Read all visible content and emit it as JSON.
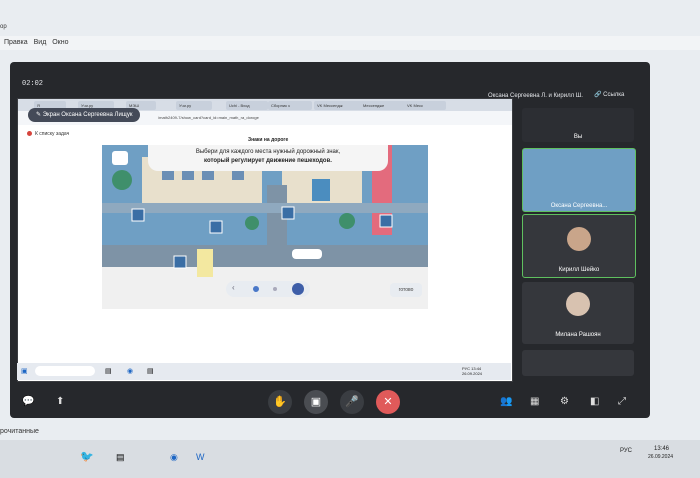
{
  "host": {
    "left_fragment": "ор",
    "menu": [
      "Правка",
      "Вид",
      "Окно"
    ],
    "bottom_fragment": "рочитанные",
    "clock_time": "13:46",
    "clock_date": "26.09.2024",
    "lang": "РУС"
  },
  "meeting": {
    "timer": "02:02",
    "title": "Оксана Сергеевна Л. и Кирилл Ш.",
    "link_label": "Ссылка",
    "screen_badge": "Экран Оксана Сергеевна Лищук",
    "you_label": "Вы"
  },
  "browser": {
    "tabs": [
      "Я",
      "Учи.ру",
      "МЭШ",
      "Учи.ру",
      "Uchi - Вход",
      "Сборник з",
      "VK Мессендж",
      "Мессендже",
      "VK Месс"
    ],
    "url": "/math2409-7/show_card?card_id=main_math_ra_doroge",
    "back_label": "К списку задач"
  },
  "task": {
    "title": "Знаки на дороге",
    "instruction_1": "Выбери для каждого места нужный дорожный знак,",
    "instruction_2": "который регулирует движение пешеходов.",
    "done_label": "готово",
    "time": "13:44",
    "date": "26.09.2024",
    "lang": "РУС"
  },
  "participants": [
    {
      "name": "Оксана Сергеевна..."
    },
    {
      "name": "Кирилл Шейко"
    },
    {
      "name": "Милана Рашоян"
    }
  ],
  "controls": [
    "hand-icon",
    "camera-off-icon",
    "mic-icon",
    "hangup-icon"
  ],
  "colors": {
    "hangup": "#e05a5a",
    "scene_blue": "#6f9fc4",
    "road": "#7e93a6"
  }
}
